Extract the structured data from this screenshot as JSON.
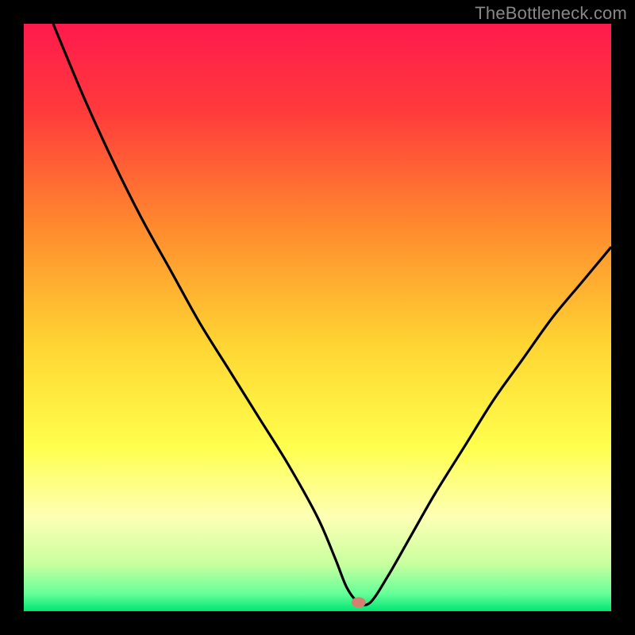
{
  "watermark": "TheBottleneck.com",
  "chart_data": {
    "type": "line",
    "title": "",
    "xlabel": "",
    "ylabel": "",
    "xlim": [
      0,
      100
    ],
    "ylim": [
      0,
      100
    ],
    "background_gradient": {
      "stops": [
        {
          "offset": 0.0,
          "color": "#ff1a4d"
        },
        {
          "offset": 0.15,
          "color": "#ff3b3b"
        },
        {
          "offset": 0.35,
          "color": "#ff8c2e"
        },
        {
          "offset": 0.55,
          "color": "#ffd633"
        },
        {
          "offset": 0.72,
          "color": "#ffff4d"
        },
        {
          "offset": 0.84,
          "color": "#fdffb5"
        },
        {
          "offset": 0.92,
          "color": "#c8ff9e"
        },
        {
          "offset": 0.97,
          "color": "#66ff99"
        },
        {
          "offset": 1.0,
          "color": "#00e673"
        }
      ]
    },
    "marker": {
      "x": 57,
      "y": 1.5,
      "color": "#d88070"
    },
    "series": [
      {
        "name": "bottleneck-curve",
        "color": "#000000",
        "x": [
          5,
          10,
          15,
          20,
          25,
          30,
          35,
          40,
          45,
          50,
          53,
          55,
          57,
          59,
          62,
          66,
          70,
          75,
          80,
          85,
          90,
          95,
          100
        ],
        "values": [
          100,
          88,
          77,
          67,
          58,
          49,
          41,
          33,
          25,
          16,
          9,
          4,
          1.5,
          1.5,
          6,
          13,
          20,
          28,
          36,
          43,
          50,
          56,
          62
        ]
      }
    ]
  }
}
